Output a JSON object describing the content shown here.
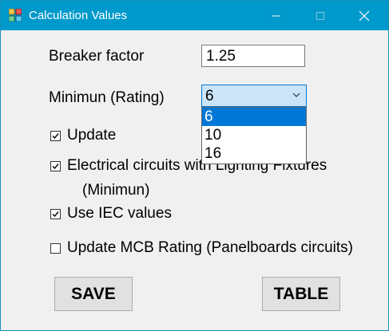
{
  "window": {
    "title": "Calculation Values",
    "minimize": "minimize",
    "maximize": "maximize",
    "close": "close"
  },
  "form": {
    "breaker_label": "Breaker factor",
    "breaker_value": "1.25",
    "minimum_label": "Minimun (Rating)",
    "minimum_value": "6",
    "minimum_options": [
      "6",
      "10",
      "16"
    ],
    "update_label": "Update",
    "update_checked": true,
    "lighting_label_line1": "Electrical circuits with Lighting Fixtures",
    "lighting_label_line2": "(Minimun)",
    "lighting_checked": true,
    "iec_label": "Use IEC values",
    "iec_checked": true,
    "mcb_label": "Update MCB Rating (Panelboards circuits)",
    "mcb_checked": false
  },
  "buttons": {
    "save": "SAVE",
    "table": "TABLE"
  },
  "colors": {
    "titlebar": "#0099cc",
    "selection": "#0078d7",
    "combo_bg": "#cce4f7"
  }
}
